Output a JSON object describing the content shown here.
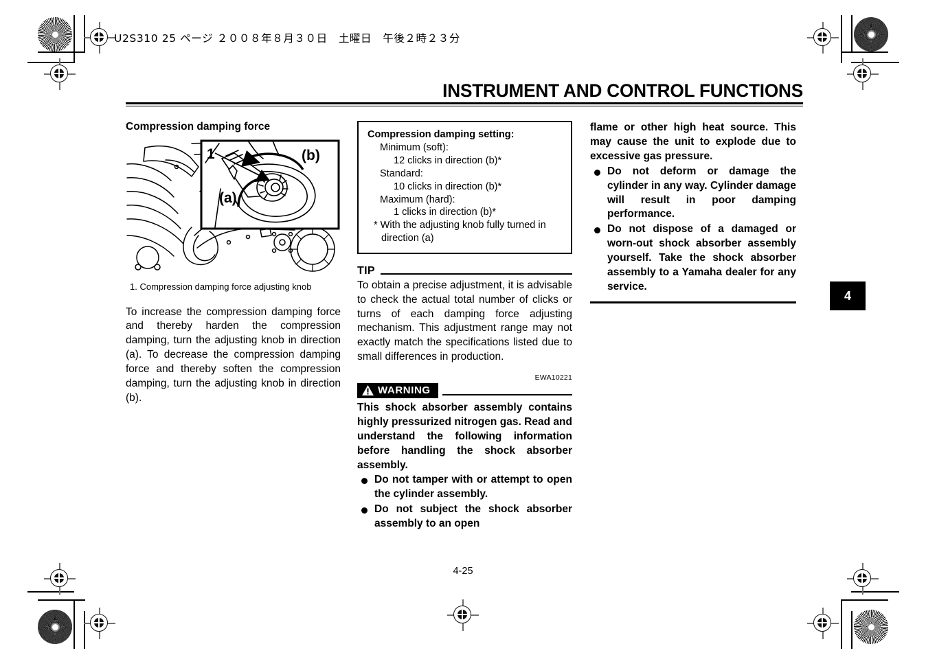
{
  "print_header": {
    "text": "U2S310  25 ページ  ２００８年８月３０日　土曜日　午後２時２３分"
  },
  "chapter": {
    "title": "INSTRUMENT AND CONTROL FUNCTIONS",
    "tab_number": "4"
  },
  "page_number": "4-25",
  "left_column": {
    "heading": "Compression damping force",
    "figure": {
      "callout_number": "1",
      "direction_a": "(a)",
      "direction_b": "(b)"
    },
    "caption": "1. Compression damping force adjusting knob",
    "paragraph": "To increase the compression damping force and thereby harden the compression damping, turn the adjusting knob in direction (a). To decrease the compression damping force and thereby soften the compression damping, turn the adjusting knob in direction (b)."
  },
  "middle_column": {
    "spec_box": {
      "title": "Compression damping setting:",
      "rows": [
        {
          "level": 1,
          "text": "Minimum (soft):"
        },
        {
          "level": 2,
          "text": "12 clicks in direction (b)*"
        },
        {
          "level": 1,
          "text": "Standard:"
        },
        {
          "level": 2,
          "text": "10 clicks in direction (b)*"
        },
        {
          "level": 1,
          "text": "Maximum (hard):"
        },
        {
          "level": 2,
          "text": "1 clicks in direction (b)*"
        }
      ],
      "footnote": "* With the adjusting knob fully turned in direction (a)"
    },
    "tip": {
      "label": "TIP",
      "text": "To obtain a precise adjustment, it is advisable to check the actual total number of clicks or turns of each damping force adjusting mechanism. This adjustment range may not exactly match the specifications listed due to small differences in production."
    },
    "warning": {
      "code": "EWA10221",
      "badge_label": "WARNING",
      "intro": "This shock absorber assembly contains highly pressurized nitrogen gas. Read and understand the following information before handling the shock absorber assembly.",
      "bullets": [
        "Do not tamper with or attempt to open the cylinder assembly.",
        "Do not subject the shock absorber assembly to an open"
      ]
    }
  },
  "right_column": {
    "continuation": "flame or other high heat source. This may cause the unit to explode due to excessive gas pressure.",
    "bullets": [
      "Do not deform or damage the cylinder in any way. Cylinder damage will result in poor damping performance.",
      "Do not dispose of a damaged or worn-out shock absorber assembly yourself. Take the shock absorber assembly to a Yamaha dealer for any service."
    ]
  }
}
